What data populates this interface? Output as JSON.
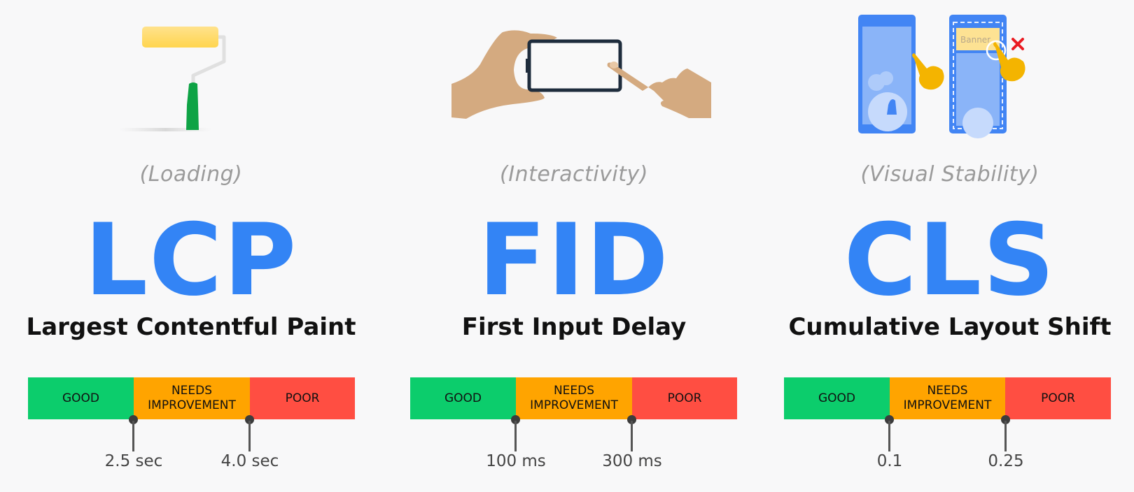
{
  "metrics": [
    {
      "id": "lcp",
      "category": "(Loading)",
      "acronym": "LCP",
      "name": "Largest Contentful Paint",
      "illustration": "paint-roller-icon",
      "segments": [
        "GOOD",
        "NEEDS IMPROVEMENT",
        "POOR"
      ],
      "thresholds": [
        "2.5 sec",
        "4.0 sec"
      ]
    },
    {
      "id": "fid",
      "category": "(Interactivity)",
      "acronym": "FID",
      "name": "First Input Delay",
      "illustration": "hand-tapping-phone-icon",
      "segments": [
        "GOOD",
        "NEEDS IMPROVEMENT",
        "POOR"
      ],
      "thresholds": [
        "100 ms",
        "300 ms"
      ]
    },
    {
      "id": "cls",
      "category": "(Visual Stability)",
      "acronym": "CLS",
      "name": "Cumulative Layout Shift",
      "illustration": "layout-shift-phones-icon",
      "banner_text": "Banner",
      "segments": [
        "GOOD",
        "NEEDS IMPROVEMENT",
        "POOR"
      ],
      "thresholds": [
        "0.1",
        "0.25"
      ]
    }
  ],
  "colors": {
    "accent": "#3384f5",
    "good": "#0ccd6c",
    "needs_improvement": "#ffa400",
    "poor": "#ff4e42",
    "background": "#f8f8f9"
  }
}
